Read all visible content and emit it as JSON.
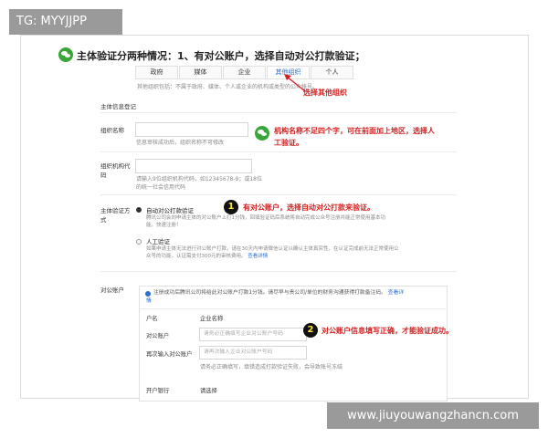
{
  "watermark": {
    "top_left": "TG: MYYJJPP",
    "bottom_right": "www.jiuyouwangzhancn.com"
  },
  "headline": "主体验证分两种情况：1、有对公账户，选择自动对公打款验证；",
  "tabs": [
    {
      "label": "政府",
      "active": false
    },
    {
      "label": "媒体",
      "active": false
    },
    {
      "label": "企业",
      "active": false
    },
    {
      "label": "其他组织",
      "active": true
    },
    {
      "label": "个人",
      "active": false
    }
  ],
  "tabs_note": "其他组织包括：不属于政府、媒体、个人或企业的机构或类型的公众帐号。",
  "section_title": "主体信息登记",
  "org_name": {
    "label": "组织名称",
    "hint": "信息审核成功后，组织名称不可修改"
  },
  "org_code": {
    "label_line1": "组织机构代",
    "label_line2": "码",
    "hint_line1": "请输入9位组织机构代码，如12345678-9；或18位",
    "hint_line2": "的统一社会信用代码"
  },
  "verify_method": {
    "label_line1": "主体验证方",
    "label_line2": "式",
    "options": [
      {
        "label": "自动对公打款验证",
        "selected": true,
        "desc_line1": "腾讯公司会向申请主体的对公账户上打1分钱，回填验证码后系统将自动完成公众号注册并能正常使用基本功",
        "desc_line2": "能。快速注册！"
      },
      {
        "label": "人工验证",
        "selected": false,
        "desc_line1": "如果申请主体无法进行对公账户打款，请在30天内申请微信认证以确认主体真实性，在认证完成前无法正常使用公",
        "desc_line2": "众号的功能，认证需支付300元的审核费用。",
        "link": "查看详情"
      }
    ]
  },
  "account": {
    "label": "对公账户",
    "info_line1": "注册成功后腾讯公司将给此对公账户打款1分钱。请尽早与贵公司/单位的财务沟通获得打款备注码。",
    "info_link": "查看详",
    "info_line2": "情",
    "rows": [
      {
        "label": "户名",
        "value": "企业名称"
      },
      {
        "label": "对公账户",
        "placeholder": "请务必正确填写企业对公账户号码"
      },
      {
        "label": "再次输入对公账户",
        "placeholder": "请再次输入企业对公账户号码"
      }
    ],
    "warning": "请务必正确填写，填错造成打款验证失败，会导致账号冻结",
    "bank_label": "开户银行",
    "bank_select": "请选择"
  },
  "annotations": {
    "select_other": "选择其他组织",
    "name_note_line1": "机构名称不足四个字，可在前面加上地区，选择人",
    "name_note_line2": "工验证。",
    "auto_note": "有对公账户，选择自动对公打款来验证。",
    "account_note": "对公账户信息填写正确，才能验证成功。",
    "badge1": "1",
    "badge2": "2"
  },
  "colors": {
    "annotation_red": "#d42020",
    "link_blue": "#2b6fd1",
    "wechat_green": "#3aa63a"
  }
}
